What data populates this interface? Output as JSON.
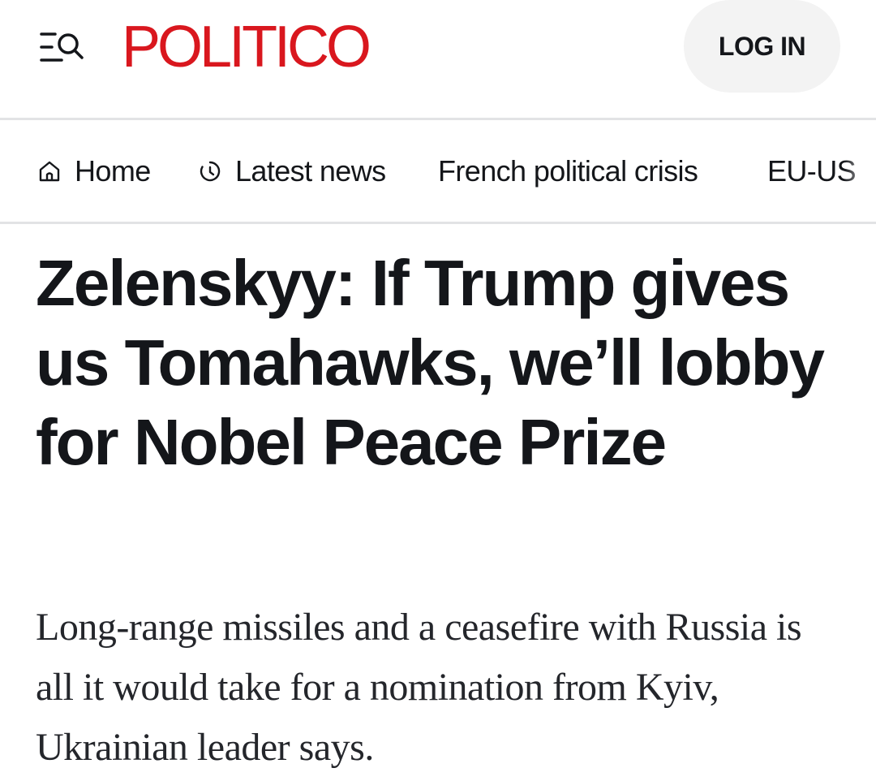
{
  "header": {
    "logo_text": "POLITICO",
    "login_label": "LOG IN",
    "brand_color": "#d9171e",
    "menu_icon": "menu-search-icon"
  },
  "nav": {
    "items": [
      {
        "label": "Home",
        "icon": "home-icon"
      },
      {
        "label": "Latest news",
        "icon": "clock-icon"
      },
      {
        "label": "French political crisis"
      },
      {
        "label": "EU-US"
      }
    ]
  },
  "article": {
    "headline": "Zelenskyy: If Trump gives us Tomahawks, we’ll lobby for Nobel Peace Prize",
    "dek": "Long-range missiles and a ceasefire with Russia is all it would take for a nomination from Kyiv, Ukrainian leader says."
  }
}
